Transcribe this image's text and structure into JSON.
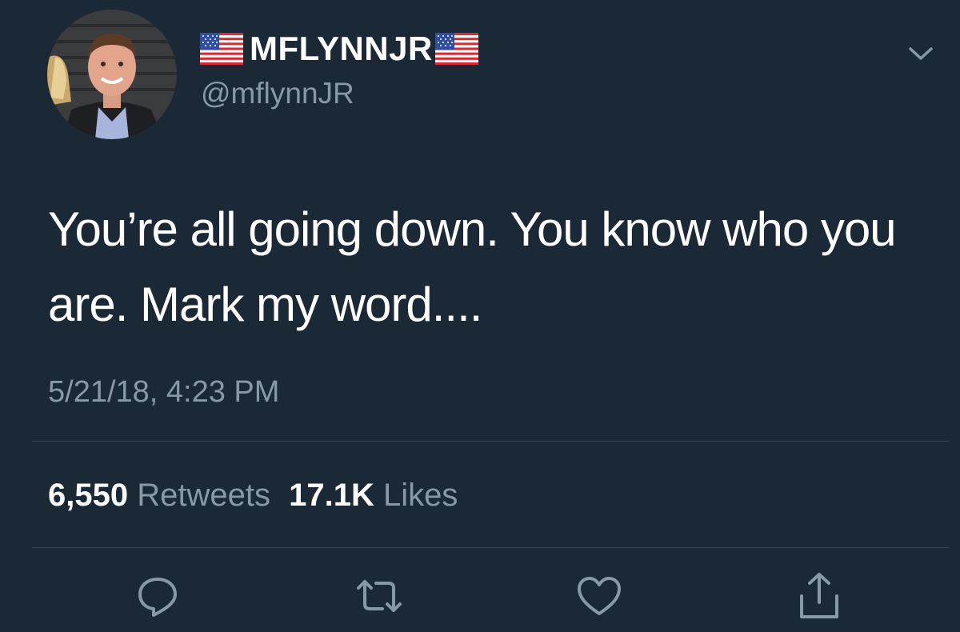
{
  "tweet": {
    "display_name": "MFLYNNJR",
    "handle": "@mflynnJR",
    "text": "You’re all going down. You know who you are. Mark my word....",
    "timestamp": "5/21/18, 4:23 PM",
    "retweets_count": "6,550",
    "retweets_label": "Retweets",
    "likes_count": "17.1K",
    "likes_label": "Likes"
  },
  "icons": {
    "name_prefix": "us-flag-icon",
    "name_suffix": "us-flag-icon",
    "menu": "chevron-down-icon",
    "actions": [
      "reply-icon",
      "retweet-icon",
      "like-icon",
      "share-icon"
    ]
  },
  "colors": {
    "background": "#1b2836",
    "primary_text": "#ffffff",
    "secondary_text": "#8899a6",
    "divider": "#38444d"
  }
}
